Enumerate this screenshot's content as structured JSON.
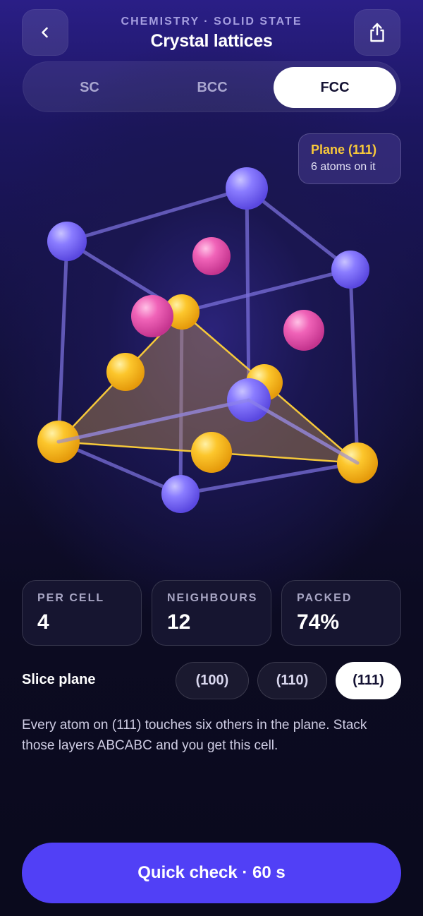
{
  "header": {
    "eyebrow": "CHEMISTRY · SOLID STATE",
    "title": "Crystal lattices",
    "back_icon": "chevron-left-icon",
    "share_icon": "share-icon"
  },
  "tabs": [
    {
      "label": "SC",
      "active": false
    },
    {
      "label": "BCC",
      "active": false
    },
    {
      "label": "FCC",
      "active": true
    }
  ],
  "plane_callout": {
    "name": "Plane (111)",
    "subtitle": "6 atoms on it"
  },
  "colors": {
    "corner_atom": "#7f72ff",
    "face_atom": "#f05fb4",
    "plane_atom": "#fcc62c",
    "plane_outline": "#f6c93a",
    "cta": "#5140f6"
  },
  "stats": [
    {
      "label": "PER CELL",
      "value": "4"
    },
    {
      "label": "NEIGHBOURS",
      "value": "12"
    },
    {
      "label": "PACKED",
      "value": "74%"
    }
  ],
  "slice": {
    "label": "Slice plane",
    "options": [
      {
        "label": "(100)",
        "active": false
      },
      {
        "label": "(110)",
        "active": false
      },
      {
        "label": "(111)",
        "active": true
      }
    ]
  },
  "description": "Every atom on (111) touches six others in the plane. Stack those layers ABCABC and you get this cell.",
  "cta": {
    "label": "Quick check · 60 s"
  }
}
